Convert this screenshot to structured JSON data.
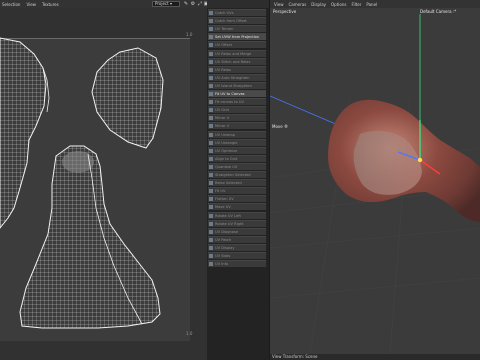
{
  "uv_editor": {
    "menu": [
      "Selection",
      "View",
      "Textures"
    ],
    "texture_dropdown": "Project",
    "tool_icons": [
      "pencil-icon",
      "gear-icon",
      "expand-icon",
      "lock-icon"
    ],
    "corner_top": "1.0",
    "corner_bottom": "1.0"
  },
  "commands": {
    "items": [
      {
        "label": "Catch UVs",
        "active": false
      },
      {
        "label": "Catch from Offset",
        "active": false
      },
      {
        "label": "UV Terrain",
        "active": false
      },
      {
        "label": "Set UVW from Projection",
        "active": true
      },
      {
        "label": "UV Offset",
        "active": false
      },
      {
        "label": "UV Relax and Merge",
        "active": false
      },
      {
        "label": "UV Stitch and Relax",
        "active": false
      },
      {
        "label": "UV Relax",
        "active": false
      },
      {
        "label": "UV Auto Straighten",
        "active": false
      },
      {
        "label": "UV Island Straighten",
        "active": false
      },
      {
        "label": "Fit UV to Canvas",
        "active": true
      },
      {
        "label": "Fit canvas to UV",
        "active": false
      },
      {
        "label": "UV Grid",
        "active": false
      },
      {
        "label": "Mirror U",
        "active": false
      },
      {
        "label": "Mirror V",
        "active": false
      },
      {
        "label": "UV Unwrap",
        "active": false
      },
      {
        "label": "UV Untangle",
        "active": false
      },
      {
        "label": "UV Optimize",
        "active": false
      },
      {
        "label": "Align to Grid",
        "active": false
      },
      {
        "label": "Quantize UV",
        "active": false
      },
      {
        "label": "Straighten Selected",
        "active": false
      },
      {
        "label": "Relax Selected",
        "active": false
      },
      {
        "label": "Fit UV",
        "active": false
      },
      {
        "label": "Flatten UV",
        "active": false
      },
      {
        "label": "Move UV",
        "active": false
      },
      {
        "label": "Rotate UV Left",
        "active": false
      },
      {
        "label": "Rotate UV Right",
        "active": false
      },
      {
        "label": "UV Diagnose",
        "active": false
      },
      {
        "label": "UV Patch",
        "active": false
      },
      {
        "label": "UV Display",
        "active": false
      },
      {
        "label": "UV Stats",
        "active": false
      },
      {
        "label": "UV Info",
        "active": false
      }
    ]
  },
  "viewport": {
    "menu": [
      "View",
      "Cameras",
      "Display",
      "Options",
      "Filter",
      "Panel"
    ],
    "view_label": "Perspective",
    "camera_label": "Default Camera :*",
    "move_label": "Move ®",
    "status_text": "View Transform: Scene",
    "colors": {
      "x_axis": "#4a78ff",
      "y_axis": "#3fe07a",
      "z_axis": "#ff3b3b"
    }
  }
}
